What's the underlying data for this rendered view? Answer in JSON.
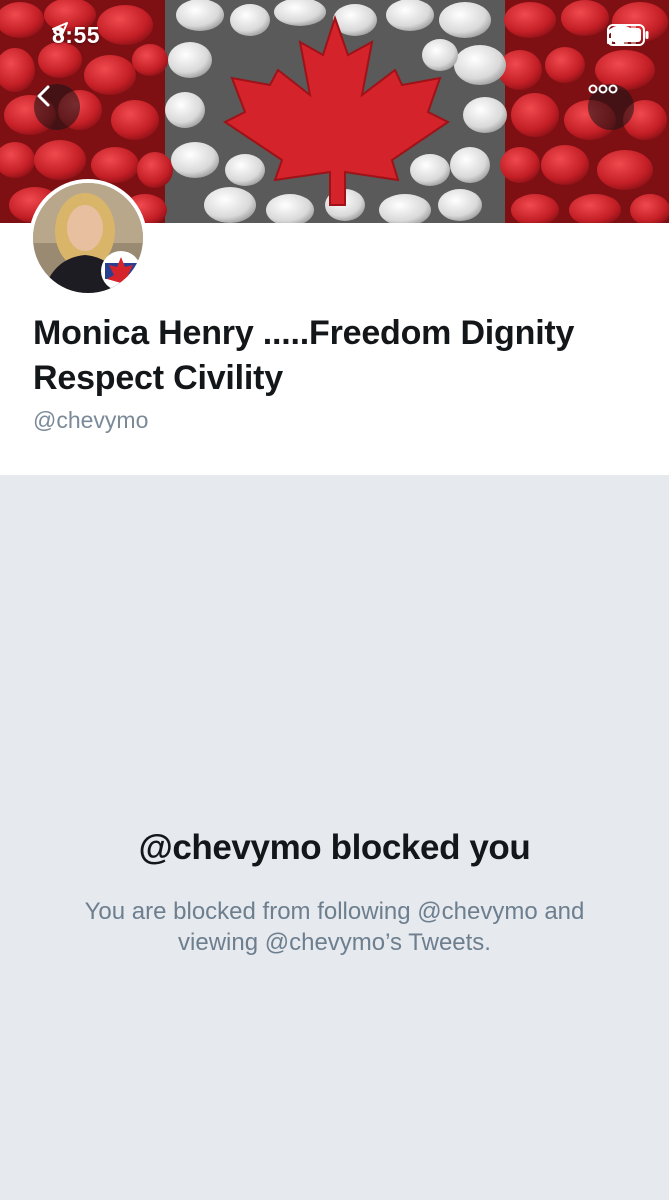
{
  "status_bar": {
    "time": "8:55",
    "location_icon": "location-arrow-icon",
    "signal_icon": "cellular-signal-icon",
    "wifi_icon": "wifi-icon",
    "battery_icon": "battery-icon"
  },
  "header": {
    "banner_icon": "canada-maple-leaf-pebbles-banner",
    "back_icon": "chevron-left-icon",
    "more_icon": "more-dots-icon"
  },
  "profile": {
    "display_name": "Monica Henry .....Freedom Dignity Respect Civility",
    "handle": "@chevymo",
    "avatar_icon": "profile-photo-avatar"
  },
  "blocked": {
    "title": "@chevymo blocked you",
    "description": "You are blocked from following @chevymo and viewing @chevymo’s Tweets."
  },
  "colors": {
    "banner_red": "#c7252b",
    "page_background": "#e6e9ee",
    "text_primary": "#14171a",
    "text_secondary": "#7b8a99"
  }
}
